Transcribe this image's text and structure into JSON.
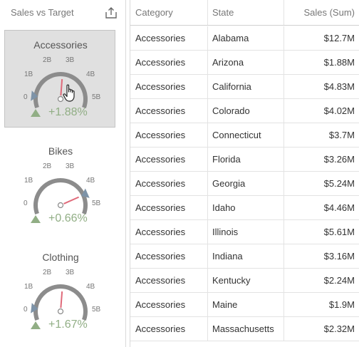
{
  "panel": {
    "title": "Sales vs Target",
    "export_icon": "export-icon"
  },
  "gauges": [
    {
      "name": "Accessories",
      "ticks": [
        "0",
        "1B",
        "2B",
        "3B",
        "4B",
        "5B"
      ],
      "value_b": 2.6,
      "target_b": 0.6,
      "delta": "+1.88%",
      "selected": true,
      "needle_color": "#e06a7a"
    },
    {
      "name": "Bikes",
      "ticks": [
        "0",
        "1B",
        "2B",
        "3B",
        "4B",
        "5B"
      ],
      "value_b": 4.0,
      "target_b": 4.0,
      "delta": "+0.66%",
      "selected": false,
      "needle_color": "#e06a7a"
    },
    {
      "name": "Clothing",
      "ticks": [
        "0",
        "1B",
        "2B",
        "3B",
        "4B",
        "5B"
      ],
      "value_b": 2.6,
      "target_b": 0.6,
      "delta": "+1.67%",
      "selected": false,
      "needle_color": "#e06a7a"
    }
  ],
  "colors": {
    "scale": "#8c8c8c",
    "target_marker": "#7d93a8",
    "delta_positive": "#91ae85",
    "selected_bg": "#e0e0e0"
  },
  "grid": {
    "headers": [
      "Category",
      "State",
      "Sales (Sum)"
    ],
    "rows": [
      [
        "Accessories",
        "Alabama",
        "$12.7M"
      ],
      [
        "Accessories",
        "Arizona",
        "$1.88M"
      ],
      [
        "Accessories",
        "California",
        "$4.83M"
      ],
      [
        "Accessories",
        "Colorado",
        "$4.02M"
      ],
      [
        "Accessories",
        "Connecticut",
        "$3.7M"
      ],
      [
        "Accessories",
        "Florida",
        "$3.26M"
      ],
      [
        "Accessories",
        "Georgia",
        "$5.24M"
      ],
      [
        "Accessories",
        "Idaho",
        "$4.46M"
      ],
      [
        "Accessories",
        "Illinois",
        "$5.61M"
      ],
      [
        "Accessories",
        "Indiana",
        "$3.16M"
      ],
      [
        "Accessories",
        "Kentucky",
        "$2.24M"
      ],
      [
        "Accessories",
        "Maine",
        "$1.9M"
      ],
      [
        "Accessories",
        "Massachusetts",
        "$2.32M"
      ]
    ]
  }
}
